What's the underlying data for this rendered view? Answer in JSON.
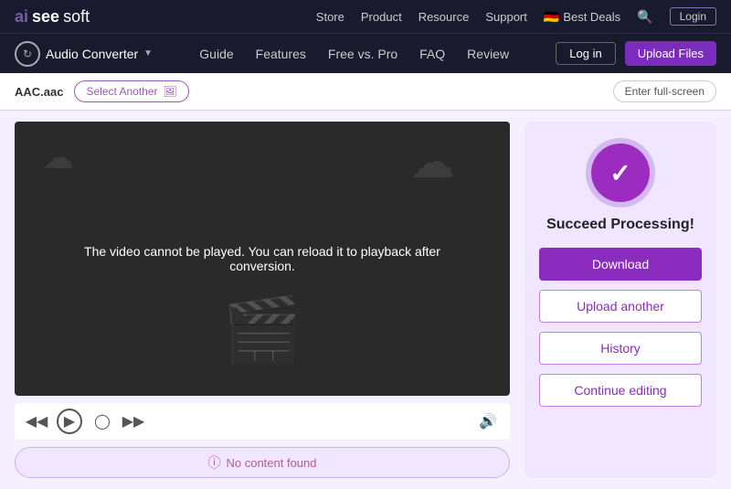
{
  "top_nav": {
    "logo_ai": "ai",
    "logo_see": "see",
    "logo_soft": "soft",
    "links": [
      {
        "label": "Store",
        "key": "store"
      },
      {
        "label": "Product",
        "key": "product"
      },
      {
        "label": "Resource",
        "key": "resource"
      },
      {
        "label": "Support",
        "key": "support"
      }
    ],
    "best_deals": "Best Deals",
    "search_label": "search",
    "login_label": "Login"
  },
  "second_nav": {
    "brand": "Audio Converter",
    "nav_links": [
      {
        "label": "Guide",
        "key": "guide"
      },
      {
        "label": "Features",
        "key": "features"
      },
      {
        "label": "Free vs. Pro",
        "key": "free-vs-pro"
      },
      {
        "label": "FAQ",
        "key": "faq"
      },
      {
        "label": "Review",
        "key": "review"
      }
    ],
    "login_label": "Log in",
    "upload_label": "Upload Files"
  },
  "toolbar": {
    "file_name": "AAC.aac",
    "select_another": "Select Another",
    "fullscreen": "Enter full-screen"
  },
  "video": {
    "message": "The video cannot be played. You can reload it to playback after conversion."
  },
  "no_content": {
    "text": "No content found"
  },
  "right_panel": {
    "success_text": "Succeed Processing!",
    "download_label": "Download",
    "upload_another_label": "Upload another",
    "history_label": "History",
    "continue_editing_label": "Continue editing"
  }
}
